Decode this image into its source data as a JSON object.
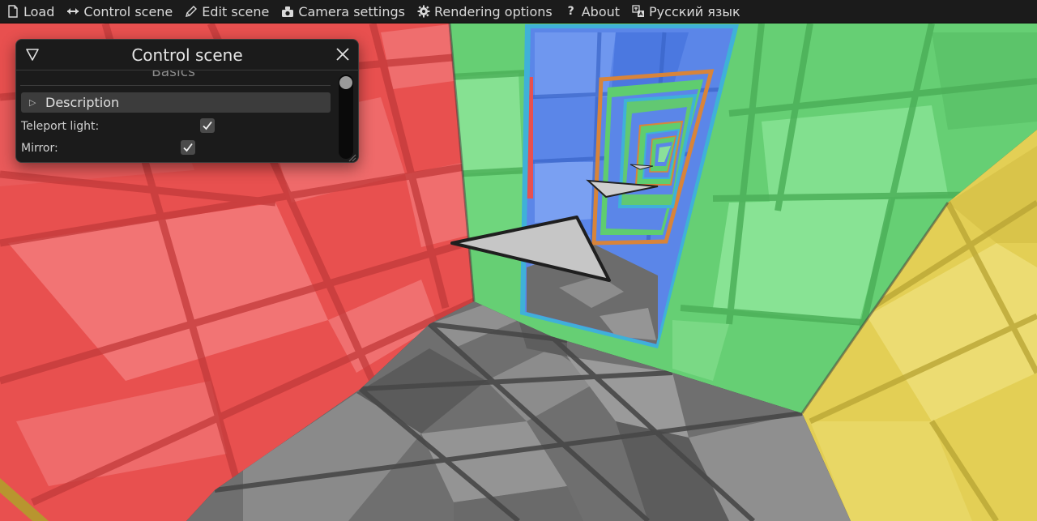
{
  "menu": {
    "items": [
      {
        "label": "Load",
        "icon": "file-icon"
      },
      {
        "label": "Control scene",
        "icon": "arrows-horizontal-icon"
      },
      {
        "label": "Edit scene",
        "icon": "pencil-icon"
      },
      {
        "label": "Camera settings",
        "icon": "camera-icon"
      },
      {
        "label": "Rendering options",
        "icon": "gear-icon"
      },
      {
        "label": "About",
        "icon": "question-icon"
      },
      {
        "label": "Русский язык",
        "icon": "translate-icon"
      }
    ]
  },
  "window": {
    "title": "Control scene",
    "section_heading": "Basics",
    "description_label": "Description",
    "rows": [
      {
        "label": "Teleport light:",
        "checked": true
      },
      {
        "label": "Mirror:",
        "checked": true
      }
    ]
  },
  "colors": {
    "red_wall": "#e8504f",
    "green_wall": "#6fd67d",
    "yellow_wall": "#e8d760",
    "blue_portal": "#5b86e8",
    "portal_frame": "#3fb1d8",
    "floor_dark": "#575757",
    "floor_light": "#8c8c8c"
  }
}
